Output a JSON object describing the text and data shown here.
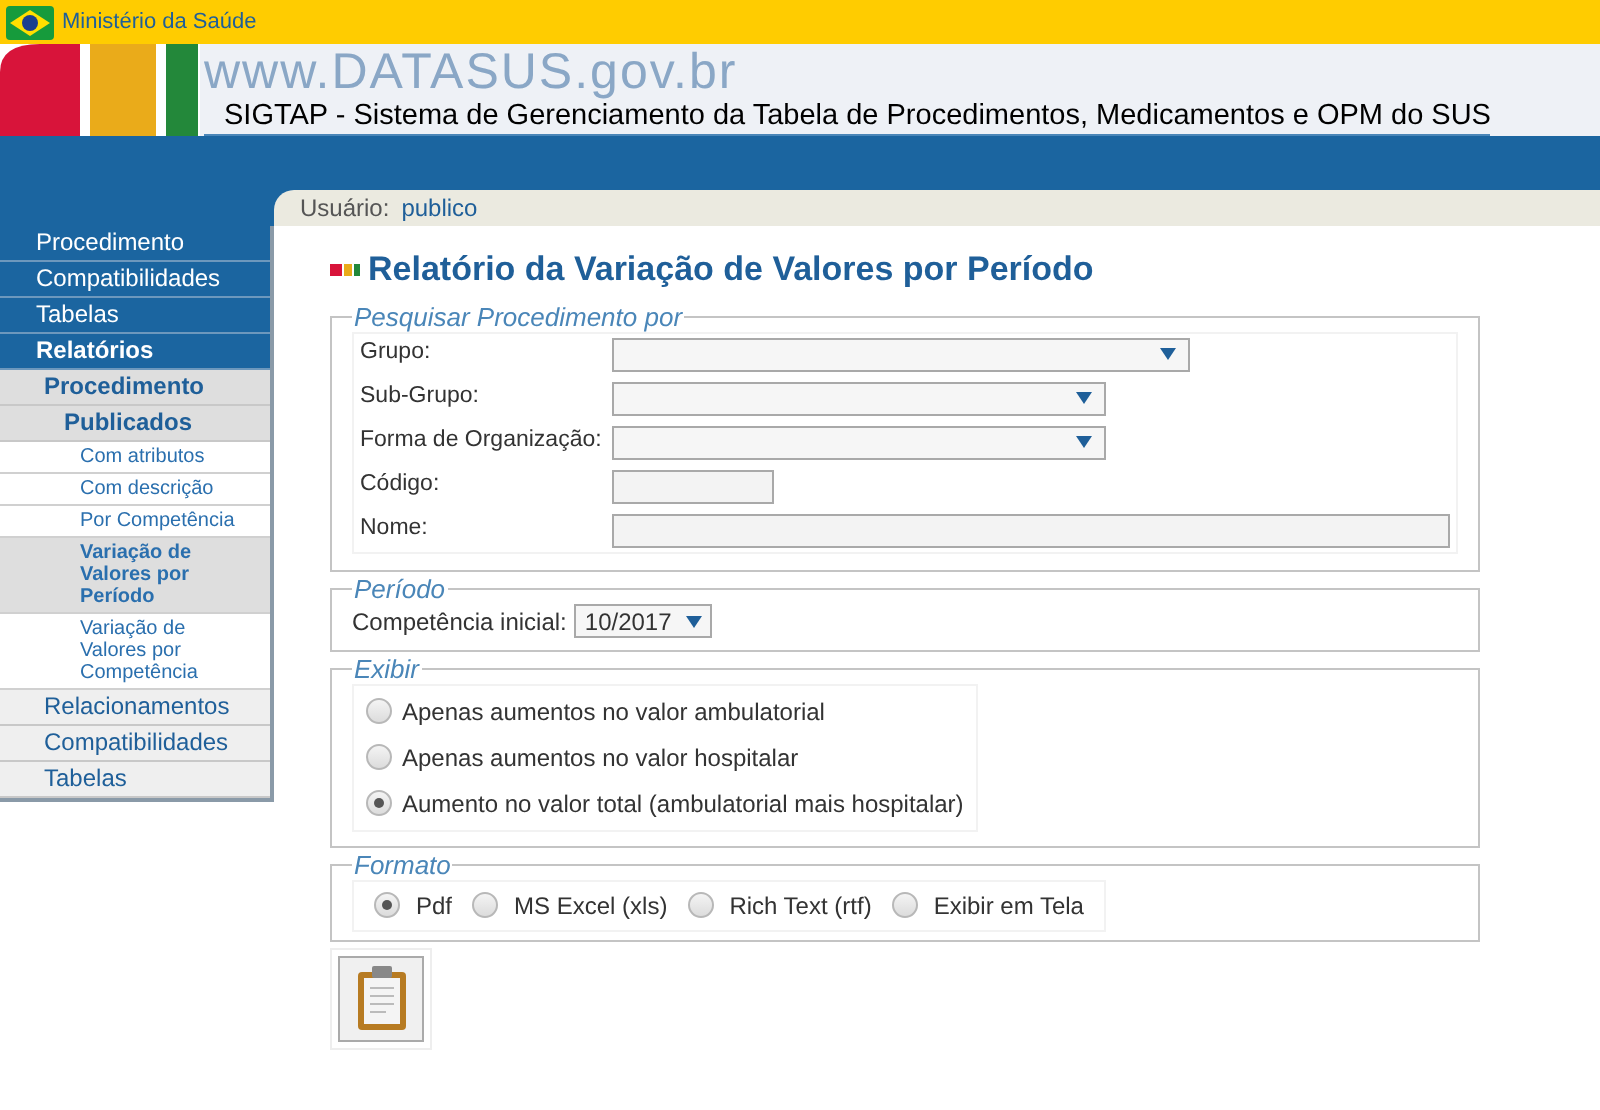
{
  "topbar": {
    "ministry": "Ministério da Saúde"
  },
  "header": {
    "site": "www.DATASUS.gov.br",
    "title": "SIGTAP - Sistema de Gerenciamento da Tabela de Procedimentos, Medicamentos e OPM do SUS"
  },
  "user": {
    "label": "Usuário:",
    "value": "publico"
  },
  "sidebar": {
    "items": [
      {
        "label": "Procedimento",
        "selected": false
      },
      {
        "label": "Compatibilidades",
        "selected": false
      },
      {
        "label": "Tabelas",
        "selected": false
      },
      {
        "label": "Relatórios",
        "selected": true,
        "children": [
          {
            "label": "Procedimento",
            "selected": true,
            "children": [
              {
                "label": "Publicados",
                "selected": true,
                "children": [
                  {
                    "label": "Com atributos",
                    "selected": false
                  },
                  {
                    "label": "Com descrição",
                    "selected": false
                  },
                  {
                    "label": "Por Competência",
                    "selected": false
                  },
                  {
                    "label": "Variação de Valores por Período",
                    "selected": true
                  },
                  {
                    "label": "Variação de Valores por Competência",
                    "selected": false
                  }
                ]
              }
            ]
          },
          {
            "label": "Relacionamentos",
            "selected": false
          },
          {
            "label": "Compatibilidades",
            "selected": false
          },
          {
            "label": "Tabelas",
            "selected": false
          }
        ]
      }
    ]
  },
  "page_title": "Relatório da Variação de Valores por Período",
  "search": {
    "legend": "Pesquisar Procedimento por",
    "fields": [
      {
        "label": "Grupo:",
        "kind": "select"
      },
      {
        "label": "Sub-Grupo:",
        "kind": "select"
      },
      {
        "label": "Forma de Organização:",
        "kind": "select"
      },
      {
        "label": "Código:",
        "kind": "text"
      },
      {
        "label": "Nome:",
        "kind": "text"
      }
    ]
  },
  "period": {
    "legend": "Período",
    "label": "Competência inicial:",
    "value": "10/2017"
  },
  "display": {
    "legend": "Exibir",
    "options": [
      {
        "label": "Apenas aumentos no valor ambulatorial",
        "selected": false
      },
      {
        "label": "Apenas aumentos no valor hospitalar",
        "selected": false
      },
      {
        "label": "Aumento no valor total (ambulatorial mais hospitalar)",
        "selected": true
      }
    ]
  },
  "format": {
    "legend": "Formato",
    "options": [
      {
        "label": "Pdf",
        "selected": true
      },
      {
        "label": "MS Excel (xls)",
        "selected": false
      },
      {
        "label": "Rich Text (rtf)",
        "selected": false
      },
      {
        "label": "Exibir em Tela",
        "selected": false
      }
    ]
  }
}
